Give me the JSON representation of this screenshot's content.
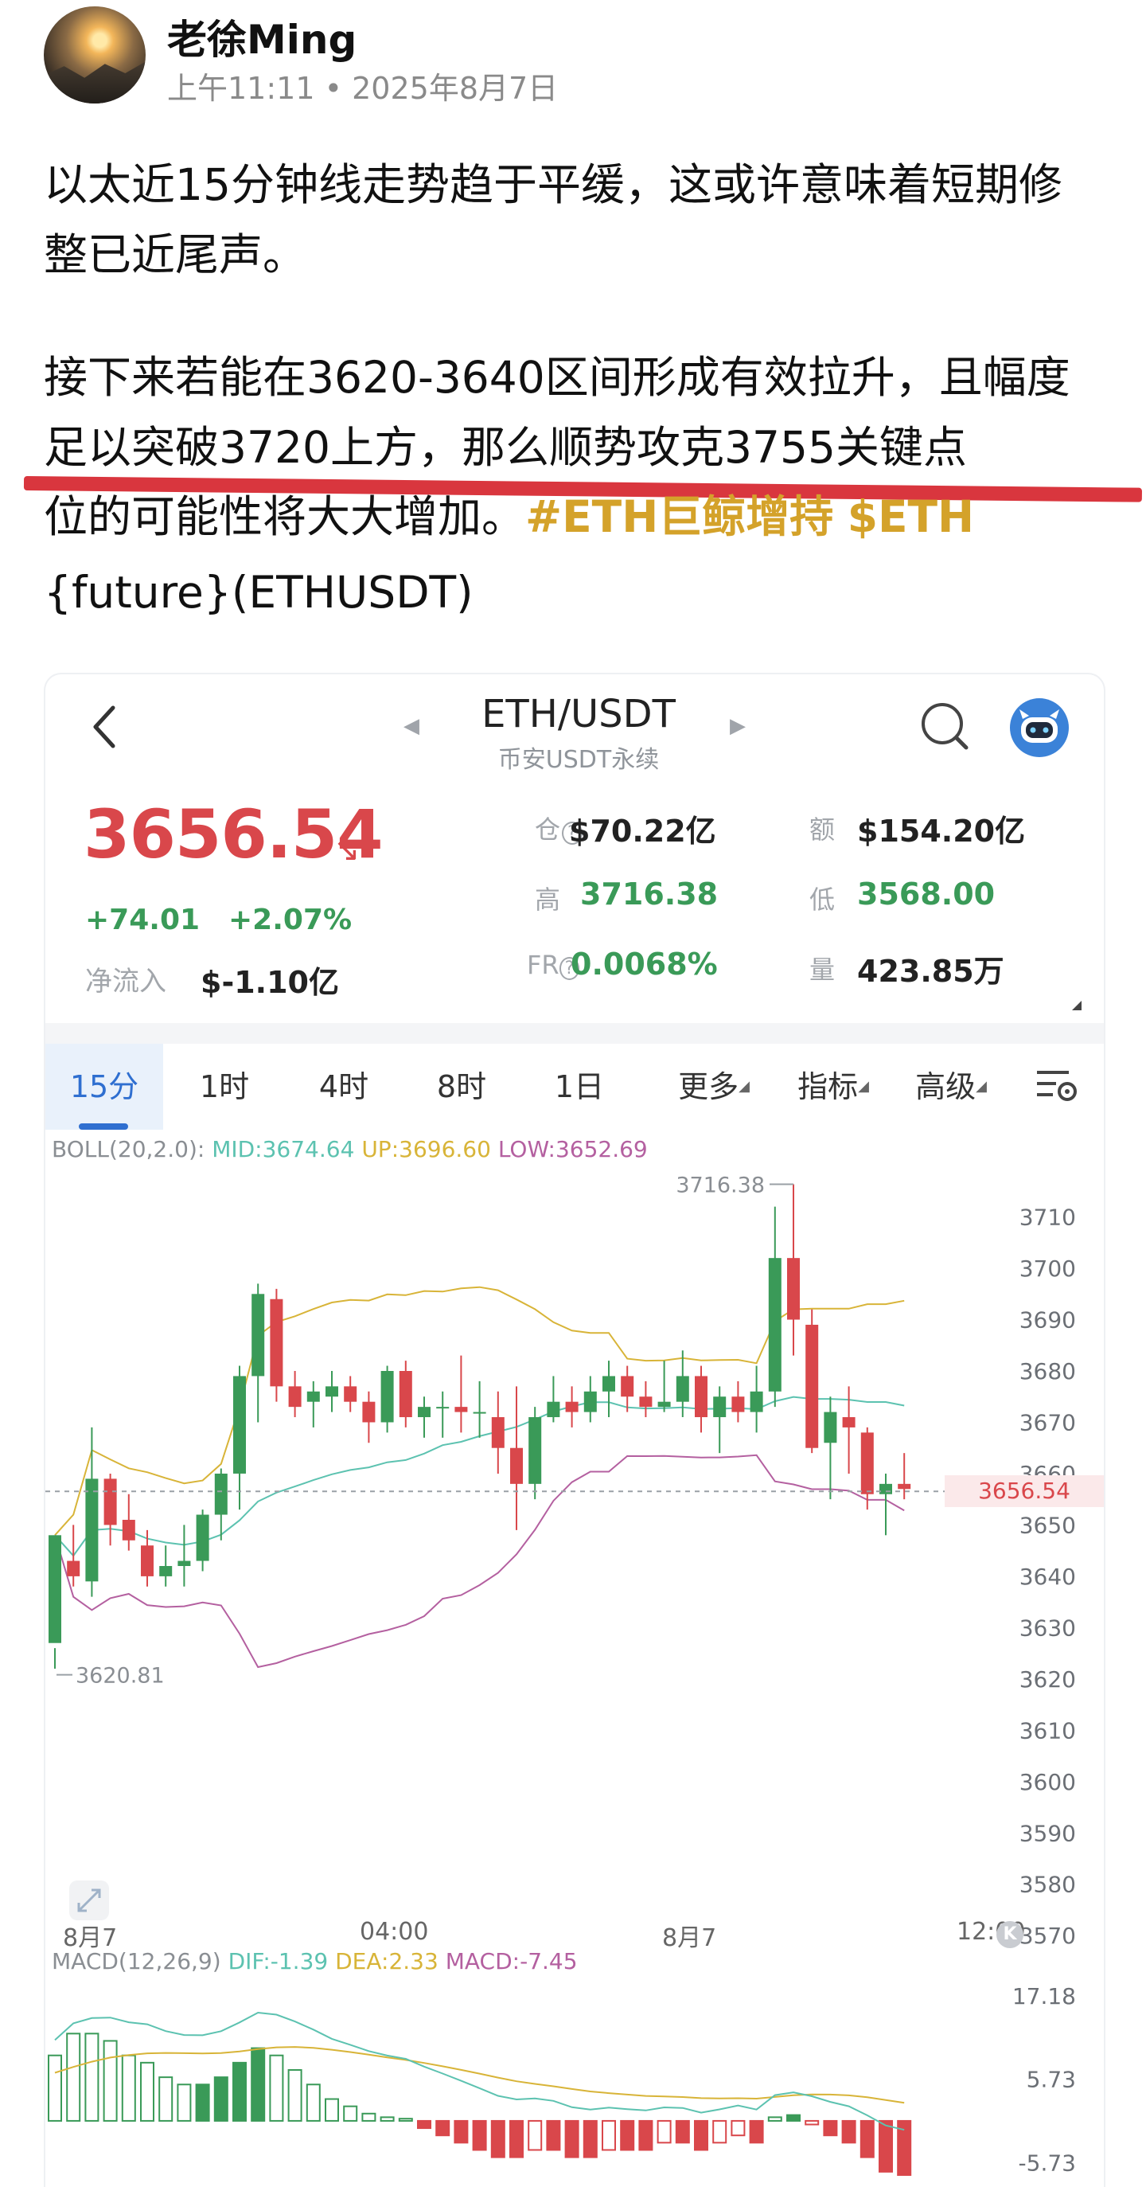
{
  "post": {
    "author": "老徐Ming",
    "time": "上午11:11",
    "date": "2025年8月7日",
    "para1": "以太近15分钟线走势趋于平缓，这或许意味着短期修整已近尾声。",
    "para2": "接下来若能在3620-3640区间形成有效拉升，且幅度足以突破3720上方，那么顺势攻克3755关键点",
    "para2_end": "位的可能性将大大增加。",
    "hashtag": "#ETH巨鲸增持",
    "cashtag": "$ETH",
    "para3": "{future}(ETHUSDT)"
  },
  "card": {
    "pair": "ETH/USDT",
    "pair_sub": "币安USDT永续",
    "price": "3656.54",
    "change_abs": "+74.01",
    "change_pct": "+2.07%",
    "netflow_label": "净流入",
    "netflow_value": "$-1.10亿",
    "stats": {
      "oi_label": "仓",
      "oi_value": "$70.22亿",
      "amount_label": "额",
      "amount_value": "$154.20亿",
      "high_label": "高",
      "high_value": "3716.38",
      "low_label": "低",
      "low_value": "3568.00",
      "fr_label": "FR",
      "fr_value": "0.0068%",
      "vol_label": "量",
      "vol_value": "423.85万"
    },
    "tabs": [
      "15分",
      "1时",
      "4时",
      "8时",
      "1日",
      "更多",
      "指标",
      "高级"
    ],
    "boll": {
      "name": "BOLL(20,2.0):",
      "mid": "MID:3674.64",
      "up": "UP:3696.60",
      "low": "LOW:3652.69"
    },
    "macd": {
      "name": "MACD(12,26,9)",
      "dif": "DIF:-1.39",
      "dea": "DEA:2.33",
      "macd": "MACD:-7.45"
    },
    "x_ticks": [
      "8月7",
      "04:00",
      "8月7",
      "12:00"
    ]
  },
  "chart_data": [
    {
      "type": "candlestick",
      "title": "ETH/USDT 15分",
      "y_ticks": [
        3710,
        3700,
        3690,
        3680,
        3670,
        3660,
        3650,
        3640,
        3630,
        3620,
        3610,
        3600,
        3590,
        3580,
        3570
      ],
      "ylim": [
        3566,
        3718
      ],
      "current_price": 3656.54,
      "annotations": {
        "high": "3716.38",
        "low": "3620.81"
      },
      "candles": [
        [
          3627,
          3648,
          3626,
          3622
        ],
        [
          3643,
          3640,
          3650,
          3638
        ],
        [
          3639,
          3659,
          3669,
          3636
        ],
        [
          3659,
          3650,
          3660,
          3646
        ],
        [
          3651,
          3647,
          3656,
          3645
        ],
        [
          3646,
          3640,
          3649,
          3638
        ],
        [
          3640,
          3642,
          3646,
          3638
        ],
        [
          3642,
          3643,
          3650,
          3638
        ],
        [
          3643,
          3652,
          3653,
          3641
        ],
        [
          3652,
          3660,
          3661,
          3647
        ],
        [
          3660,
          3679,
          3681,
          3653
        ],
        [
          3679,
          3695,
          3697,
          3670
        ],
        [
          3694,
          3677,
          3696,
          3674
        ],
        [
          3677,
          3673,
          3680,
          3671
        ],
        [
          3674,
          3676,
          3678,
          3669
        ],
        [
          3675,
          3677,
          3680,
          3672
        ],
        [
          3677,
          3674,
          3679,
          3672
        ],
        [
          3674,
          3670,
          3676,
          3666
        ],
        [
          3670,
          3680,
          3681,
          3668
        ],
        [
          3680,
          3671,
          3682,
          3669
        ],
        [
          3671,
          3673,
          3675,
          3667
        ],
        [
          3673,
          3673,
          3676,
          3667
        ],
        [
          3673,
          3672,
          3683,
          3668
        ],
        [
          3672,
          3672,
          3678,
          3667
        ],
        [
          3671,
          3665,
          3676,
          3660
        ],
        [
          3665,
          3658,
          3677,
          3649
        ],
        [
          3658,
          3671,
          3673,
          3655
        ],
        [
          3671,
          3674,
          3679,
          3670
        ],
        [
          3674,
          3672,
          3677,
          3669
        ],
        [
          3672,
          3676,
          3679,
          3670
        ],
        [
          3676,
          3679,
          3682,
          3671
        ],
        [
          3679,
          3675,
          3681,
          3672
        ],
        [
          3675,
          3673,
          3678,
          3671
        ],
        [
          3673,
          3674,
          3682,
          3672
        ],
        [
          3674,
          3679,
          3684,
          3671
        ],
        [
          3679,
          3671,
          3681,
          3668
        ],
        [
          3671,
          3675,
          3677,
          3664
        ],
        [
          3675,
          3672,
          3678,
          3670
        ],
        [
          3672,
          3676,
          3681,
          3668
        ],
        [
          3676,
          3702,
          3712,
          3673
        ],
        [
          3702,
          3690,
          3716.38,
          3683
        ],
        [
          3689,
          3665,
          3692,
          3664
        ],
        [
          3666,
          3672,
          3675,
          3655
        ],
        [
          3671,
          3669,
          3677,
          3660
        ],
        [
          3668,
          3656,
          3669,
          3653
        ],
        [
          3656,
          3658,
          3660,
          3648
        ],
        [
          3658,
          3657,
          3664,
          3655
        ]
      ],
      "boll_mid_last": 3674.64,
      "boll_up_last": 3696.6,
      "boll_low_last": 3652.69
    },
    {
      "type": "bar",
      "title": "MACD(12,26,9)",
      "y_ticks": [
        17.18,
        5.73,
        -5.73
      ],
      "histogram": [
        9,
        12,
        12,
        11,
        9,
        8,
        6,
        5,
        5,
        6,
        8,
        10,
        9,
        7,
        5,
        3,
        2,
        1,
        0.5,
        0.3,
        -1,
        -2,
        -3,
        -4,
        -5,
        -5,
        -4,
        -4,
        -5,
        -5,
        -4,
        -4,
        -4,
        -3,
        -3,
        -4,
        -3,
        -2,
        -3,
        0.5,
        0.8,
        -0.5,
        -2,
        -3,
        -5,
        -7,
        -7.45
      ],
      "dif_last": -1.39,
      "dea_last": 2.33,
      "macd_last": -7.45
    }
  ]
}
